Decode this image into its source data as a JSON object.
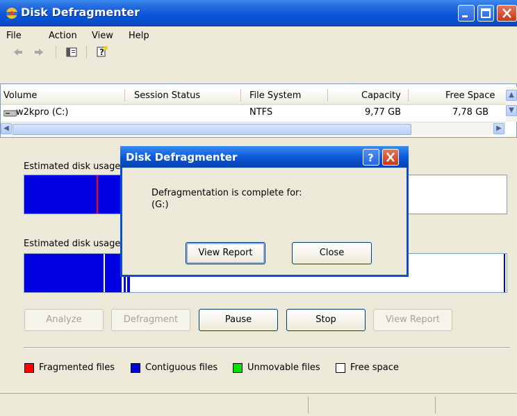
{
  "window": {
    "title": "Disk Defragmenter"
  },
  "menu": {
    "items": [
      "File",
      "Action",
      "View",
      "Help"
    ]
  },
  "list": {
    "columns": [
      "Volume",
      "Session Status",
      "File System",
      "Capacity",
      "Free Space"
    ],
    "rows": [
      {
        "volume": "w2kpro (C:)",
        "status": "",
        "fs": "NTFS",
        "capacity": "9,77 GB",
        "free": "7,78 GB"
      }
    ]
  },
  "analysis": {
    "label_before": "Estimated disk usage before defragmentation:",
    "label_after": "Estimated disk usage after defragmentation:"
  },
  "buttons": {
    "analyze": "Analyze",
    "defragment": "Defragment",
    "pause": "Pause",
    "stop": "Stop",
    "view_report": "View Report"
  },
  "legend": {
    "fragmented": "Fragmented files",
    "contiguous": "Contiguous files",
    "unmovable": "Unmovable files",
    "free": "Free space"
  },
  "colors": {
    "fragmented": "#ff0000",
    "contiguous": "#0000e0",
    "unmovable": "#00e000",
    "free": "#ffffff",
    "titlebar": "#0a55d8"
  },
  "dialog": {
    "title": "Disk Defragmenter",
    "message_line1": "Defragmentation is complete for:",
    "message_line2": "(G:)",
    "view_report": "View Report",
    "close": "Close"
  }
}
